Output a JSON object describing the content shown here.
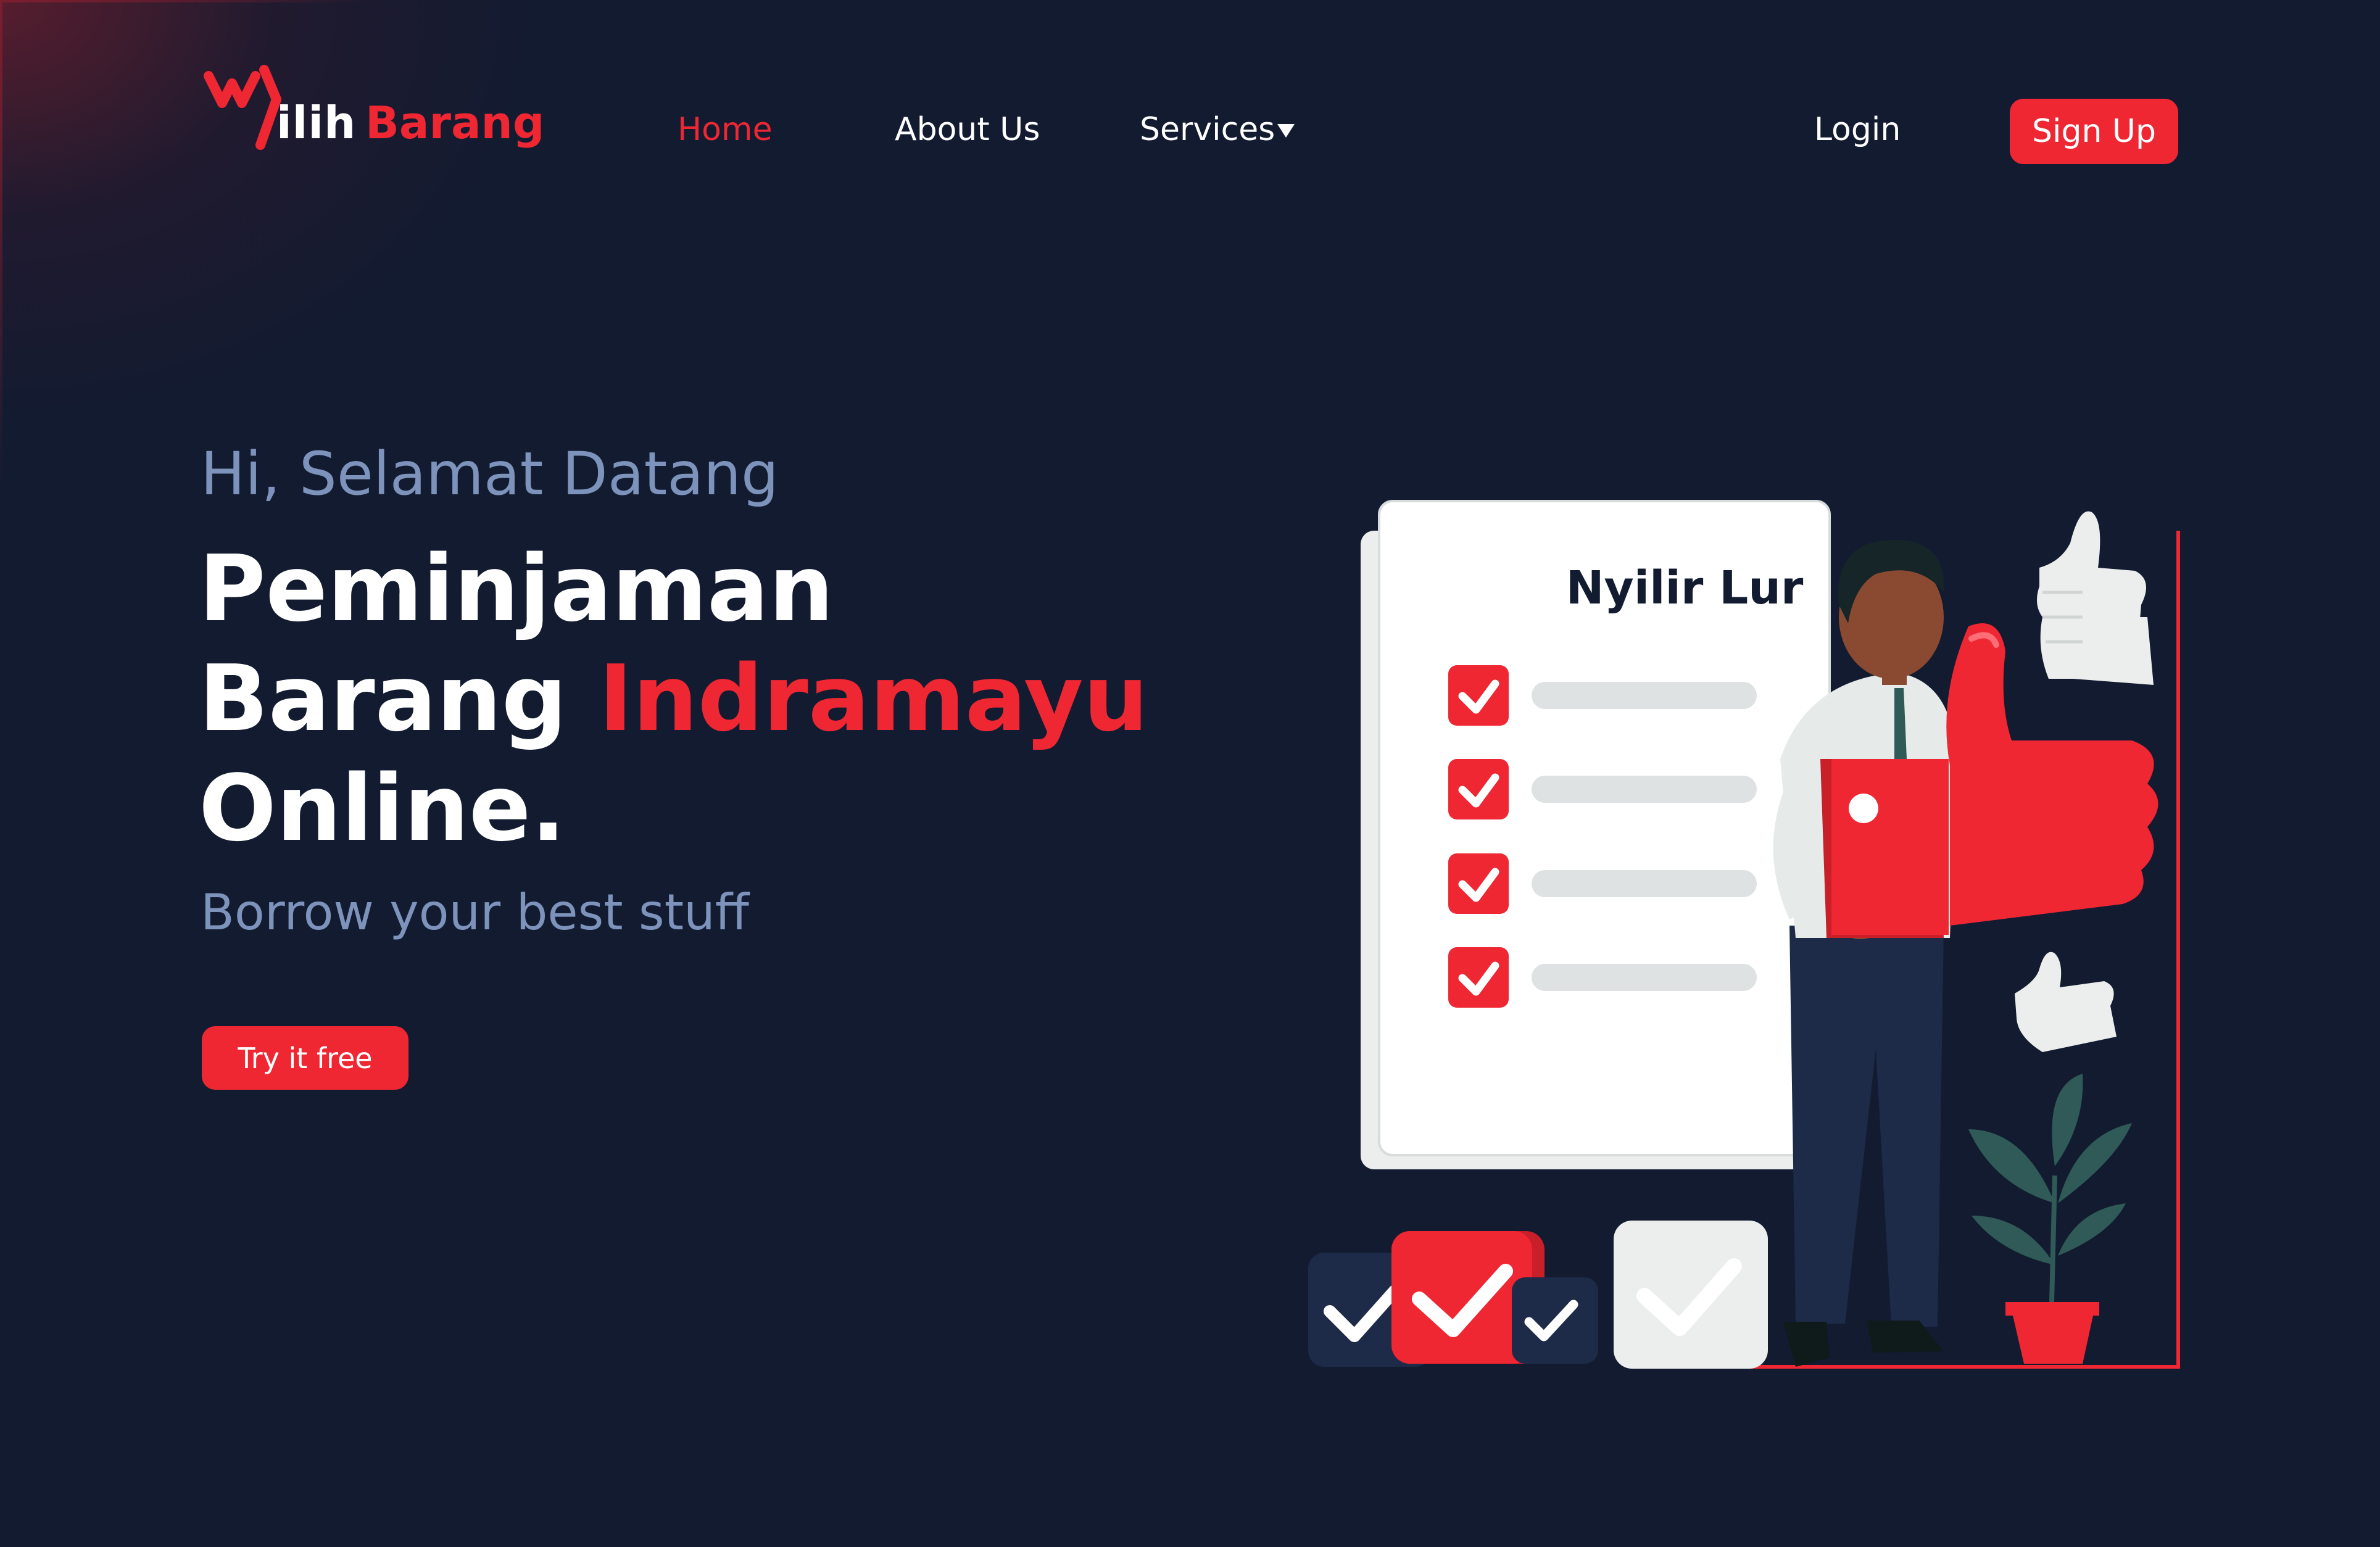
{
  "brand": {
    "logo_prefix": "ilih",
    "logo_suffix": "Barang"
  },
  "nav": {
    "home": "Home",
    "about": "About Us",
    "services": "Services",
    "login": "Login",
    "signup": "Sign Up"
  },
  "hero": {
    "greeting": "Hi, Selamat Datang",
    "headline_line1": "Peminjaman",
    "headline_line2a": "Barang ",
    "headline_line2b": "Indramayu",
    "headline_line3": "Online.",
    "tagline": "Borrow your best stuff",
    "cta": "Try it free"
  },
  "illustration": {
    "card_title": "Nyilir Lur",
    "icons": [
      "checkbox-icon",
      "thumbs-up-icon",
      "plant-icon",
      "person-illustration"
    ]
  },
  "colors": {
    "background": "#121b30",
    "accent": "#ee2733",
    "muted_text": "#7d93bb",
    "text": "#ffffff"
  }
}
